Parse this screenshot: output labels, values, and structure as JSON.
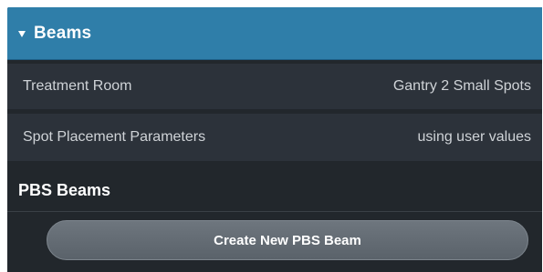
{
  "section": {
    "title": "Beams",
    "icon": "caret-down-icon"
  },
  "rows": [
    {
      "label": "Treatment Room",
      "value": "Gantry 2 Small Spots"
    },
    {
      "label": "Spot Placement Parameters",
      "value": "using user values"
    }
  ],
  "pbs": {
    "heading": "PBS Beams",
    "create_button": "Create New PBS Beam"
  },
  "colors": {
    "header_bg": "#2f7ea9",
    "panel_bg": "#22272c",
    "row_bg": "#2c323a",
    "button_bg": "#5f676f"
  }
}
